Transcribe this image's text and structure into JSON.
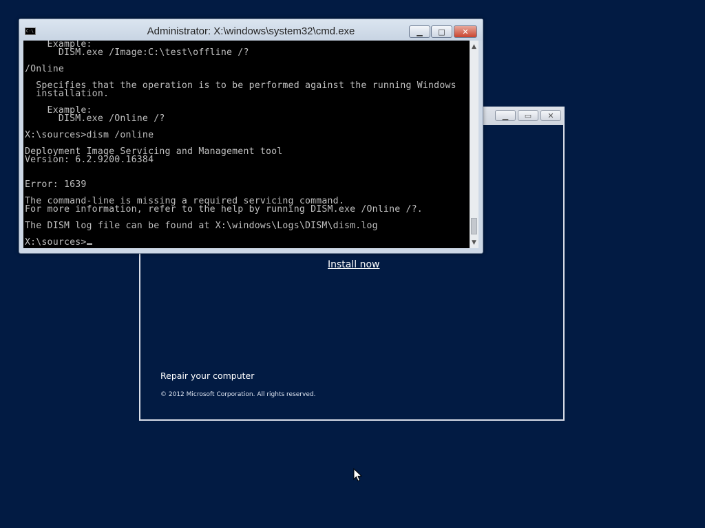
{
  "setup": {
    "install_now": "Install now",
    "repair": "Repair your computer",
    "copyright": "© 2012 Microsoft Corporation. All rights reserved."
  },
  "cmd": {
    "title": "Administrator: X:\\windows\\system32\\cmd.exe",
    "icon_text": "C:\\",
    "lines": [
      "    Example:",
      "      DISM.exe /Image:C:\\test\\offline /?",
      "",
      "/Online",
      "",
      "  Specifies that the operation is to be performed against the running Windows",
      "  installation.",
      "",
      "    Example:",
      "      DISM.exe /Online /?",
      "",
      "X:\\sources>dism /online",
      "",
      "Deployment Image Servicing and Management tool",
      "Version: 6.2.9200.16384",
      "",
      "",
      "Error: 1639",
      "",
      "The command-line is missing a required servicing command.",
      "For more information, refer to the help by running DISM.exe /Online /?.",
      "",
      "The DISM log file can be found at X:\\windows\\Logs\\DISM\\dism.log",
      ""
    ],
    "prompt": "X:\\sources>"
  }
}
